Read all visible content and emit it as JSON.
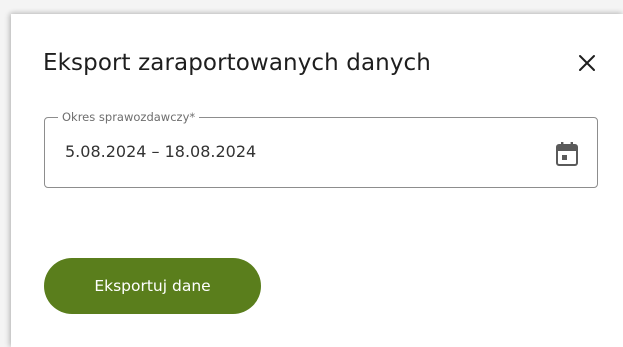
{
  "dialog": {
    "title": "Eksport zaraportowanych danych",
    "close_icon": "close-icon"
  },
  "period_field": {
    "label": "Okres sprawozdawczy*",
    "value": "5.08.2024 – 18.08.2024",
    "icon": "calendar-icon"
  },
  "actions": {
    "export_label": "Eksportuj dane"
  },
  "colors": {
    "primary": "#5a7e1c",
    "title_text": "#1e1e1e",
    "border": "#8d8d8d"
  }
}
